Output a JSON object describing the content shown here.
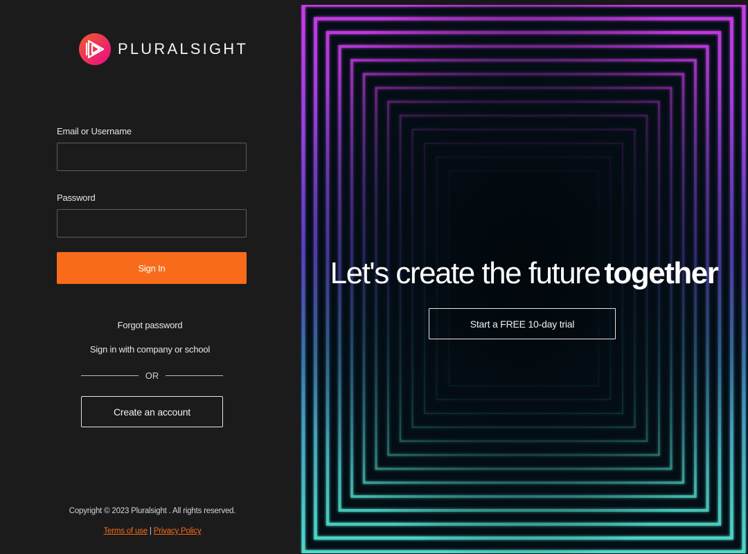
{
  "brand": {
    "name": "PLURALSIGHT",
    "logo_icon": "play-triangle-logo",
    "accent": "#f86b1a",
    "logo_gradient": [
      "#f15b2a",
      "#e80a89"
    ]
  },
  "form": {
    "email_label": "Email or Username",
    "email_value": "",
    "password_label": "Password",
    "password_value": "",
    "signin_label": "Sign In"
  },
  "links": {
    "forgot": "Forgot password",
    "company": "Sign in with company or school",
    "or": "OR",
    "create": "Create an account"
  },
  "footer": {
    "copyright": "Copyright © 2023 Pluralsight . All rights reserved.",
    "terms": "Terms of use",
    "separator": "|",
    "privacy": "Privacy Policy"
  },
  "hero": {
    "headline_light": "Let's create the future",
    "headline_bold": "together",
    "cta": "Start a FREE 10-day trial"
  },
  "colors": {
    "left_bg": "#1b1b1b",
    "right_bg": "#030d14",
    "neon_top": "#c83ce6",
    "neon_bottom": "#4fd8c8"
  }
}
